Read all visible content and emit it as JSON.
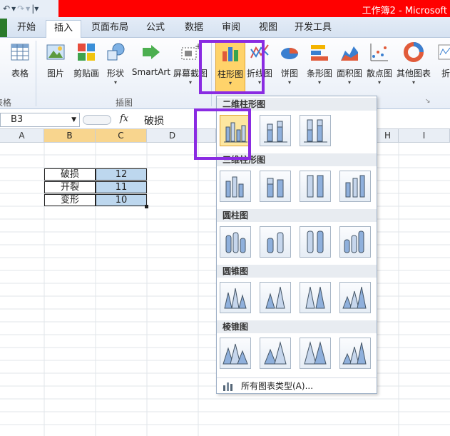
{
  "titlebar": {
    "title": "工作簿2 - Microsoft",
    "undo": "↶",
    "redo": "↷"
  },
  "tabs": [
    {
      "label": "开始"
    },
    {
      "label": "插入",
      "active": true
    },
    {
      "label": "页面布局"
    },
    {
      "label": "公式"
    },
    {
      "label": "数据"
    },
    {
      "label": "审阅"
    },
    {
      "label": "视图"
    },
    {
      "label": "开发工具"
    }
  ],
  "ribbon": {
    "table_group": {
      "table_label": "表格",
      "group_label": "表格"
    },
    "illustrations": {
      "group_label": "插图",
      "items": [
        {
          "label": "图片",
          "icon": "picture-icon"
        },
        {
          "label": "剪贴画",
          "icon": "clipart-icon"
        },
        {
          "label": "形状",
          "icon": "shapes-icon"
        },
        {
          "label": "SmartArt",
          "icon": "smartart-icon"
        },
        {
          "label": "屏幕截图",
          "icon": "screenshot-icon"
        }
      ]
    },
    "charts": [
      {
        "label": "柱形图",
        "icon": "column-chart-icon"
      },
      {
        "label": "折线图",
        "icon": "line-chart-icon"
      },
      {
        "label": "饼图",
        "icon": "pie-chart-icon"
      },
      {
        "label": "条形图",
        "icon": "bar-chart-icon"
      },
      {
        "label": "面积图",
        "icon": "area-chart-icon"
      },
      {
        "label": "散点图",
        "icon": "scatter-chart-icon"
      },
      {
        "label": "其他图表",
        "icon": "other-charts-icon"
      },
      {
        "label": "折",
        "icon": "sparkline-icon"
      }
    ]
  },
  "formula_bar": {
    "name_box": "B3",
    "fx": "fx",
    "value": "破损"
  },
  "columns": [
    "A",
    "B",
    "C",
    "D",
    "H",
    "I"
  ],
  "cells": [
    {
      "label": "破损",
      "value": "12"
    },
    {
      "label": "开裂",
      "value": "11"
    },
    {
      "label": "变形",
      "value": "10"
    }
  ],
  "gallery": {
    "sections": [
      {
        "title": "二维柱形图",
        "count": 3
      },
      {
        "title": "三维柱形图",
        "count": 4
      },
      {
        "title": "圆柱图",
        "count": 4
      },
      {
        "title": "圆锥图",
        "count": 4
      },
      {
        "title": "棱锥图",
        "count": 4
      }
    ],
    "all_types_label": "所有图表类型(A)..."
  }
}
